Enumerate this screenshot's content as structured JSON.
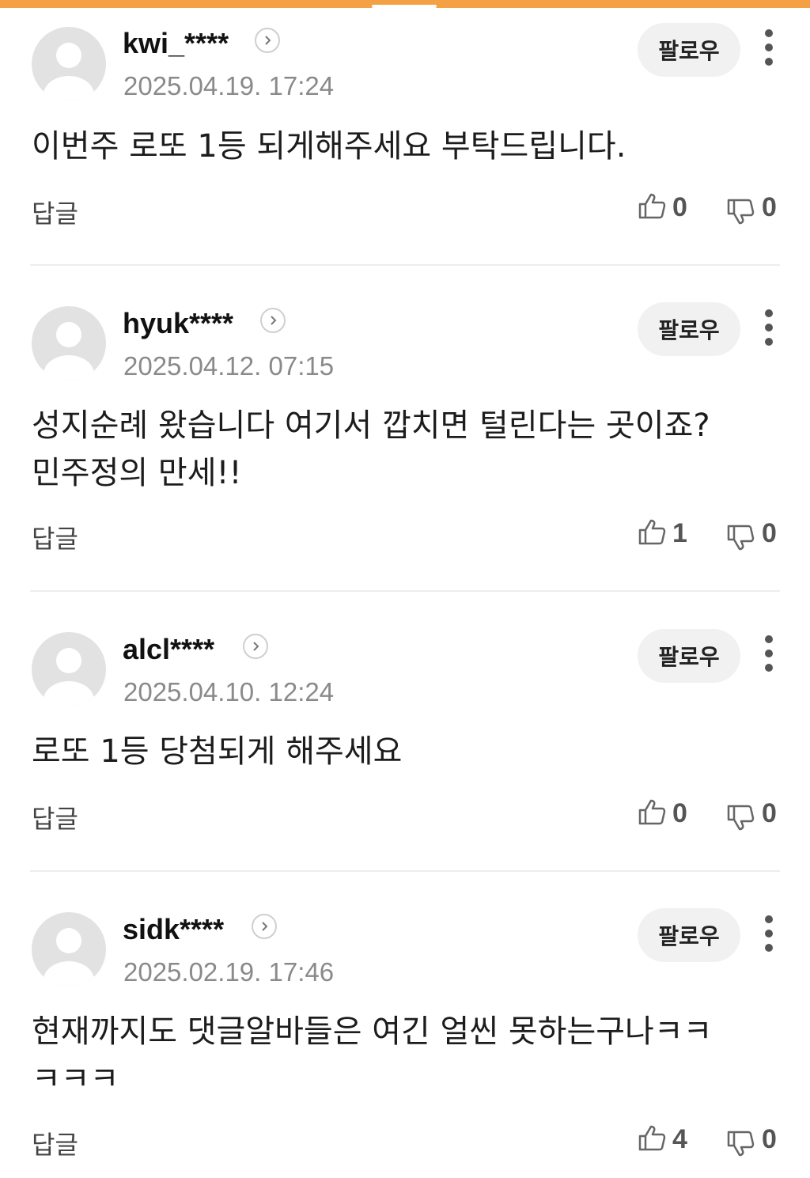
{
  "comments": [
    {
      "username": "kwi_****",
      "timestamp": "2025.04.19. 17:24",
      "follow_label": "팔로우",
      "text": "이번주 로또 1등 되게해주세요 부탁드립니다.",
      "reply_label": "답글",
      "likes": "0",
      "dislikes": "0"
    },
    {
      "username": "hyuk****",
      "timestamp": "2025.04.12. 07:15",
      "follow_label": "팔로우",
      "text": "성지순례 왔습니다 여기서 깝치면 털린다는 곳이죠?\n민주정의 만세!!",
      "reply_label": "답글",
      "likes": "1",
      "dislikes": "0"
    },
    {
      "username": "alcl****",
      "timestamp": "2025.04.10. 12:24",
      "follow_label": "팔로우",
      "text": "로또 1등 당첨되게 해주세요",
      "reply_label": "답글",
      "likes": "0",
      "dislikes": "0"
    },
    {
      "username": "sidk****",
      "timestamp": "2025.02.19. 17:46",
      "follow_label": "팔로우",
      "text": "현재까지도 댓글알바들은 여긴 얼씬 못하는구나ㅋㅋ\nㅋㅋㅋ",
      "reply_label": "답글",
      "likes": "4",
      "dislikes": "0"
    }
  ],
  "icons": {
    "avatar": "default-avatar-icon",
    "profile": "chevron-right-icon",
    "more": "more-vertical-icon",
    "like": "thumbs-up-icon",
    "dislike": "thumbs-down-icon"
  },
  "colors": {
    "accent": "#f4a146",
    "follow_bg": "#f1f1f1",
    "avatar_bg": "#e2e2e2",
    "timestamp": "#8a8a8a"
  }
}
